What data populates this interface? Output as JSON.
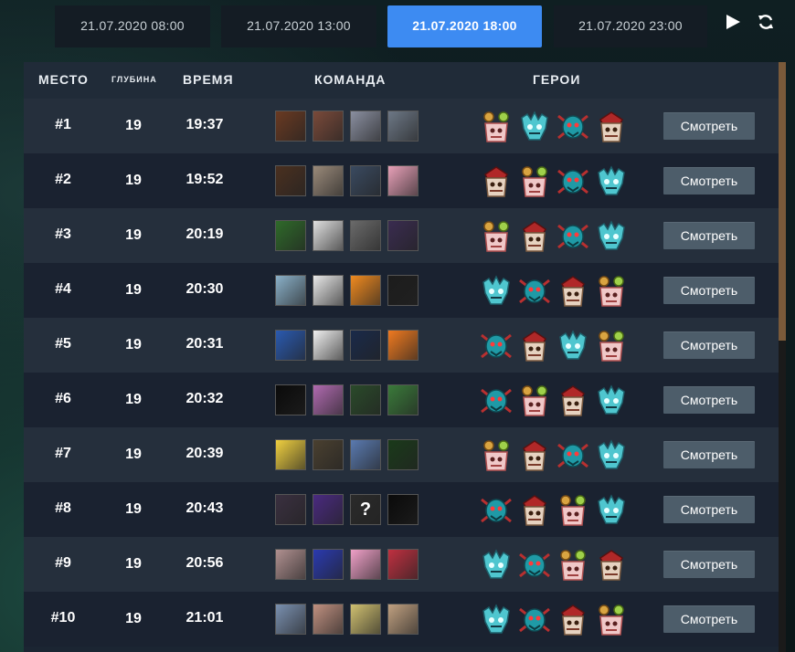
{
  "tabs": [
    {
      "label": "21.07.2020 08:00",
      "active": false
    },
    {
      "label": "21.07.2020 13:00",
      "active": false
    },
    {
      "label": "21.07.2020 18:00",
      "active": true
    },
    {
      "label": "21.07.2020 23:00",
      "active": false
    }
  ],
  "controls": {
    "play_icon": "play-icon",
    "refresh_icon": "refresh-icon"
  },
  "headers": {
    "place": "МЕСТО",
    "depth": "ГЛУБИНА",
    "time": "ВРЕМЯ",
    "team": "КОМАНДА",
    "heroes": "ГЕРОИ"
  },
  "watch_label": "Смотреть",
  "rows": [
    {
      "place": "#1",
      "depth": "19",
      "time": "19:37",
      "avatars": [
        "#6a3a22",
        "#7a4a3a",
        "#8a8fa0",
        "#6d7886"
      ],
      "heroes": [
        "shaman",
        "lich",
        "spider",
        "shaman-red"
      ]
    },
    {
      "place": "#2",
      "depth": "19",
      "time": "19:52",
      "avatars": [
        "#4a3020",
        "#9a8a7a",
        "#3a4a60",
        "#e8a0b8"
      ],
      "heroes": [
        "shaman-red",
        "shaman",
        "spider",
        "lich"
      ]
    },
    {
      "place": "#3",
      "depth": "19",
      "time": "20:19",
      "avatars": [
        "#2f6a2a",
        "#e0e0e0",
        "#6a6a6a",
        "#3a2c50"
      ],
      "heroes": [
        "shaman",
        "shaman-red",
        "spider",
        "lich"
      ]
    },
    {
      "place": "#4",
      "depth": "19",
      "time": "20:30",
      "avatars": [
        "#8ab0c8",
        "#e8e8e8",
        "#f08a20",
        "#1c1c1c"
      ],
      "heroes": [
        "lich",
        "spider",
        "shaman-red",
        "shaman"
      ]
    },
    {
      "place": "#5",
      "depth": "19",
      "time": "20:31",
      "avatars": [
        "#2a5ab0",
        "#f0f0f0",
        "#1a2a4a",
        "#f07a20"
      ],
      "heroes": [
        "spider",
        "shaman-red",
        "lich",
        "shaman"
      ]
    },
    {
      "place": "#6",
      "depth": "19",
      "time": "20:32",
      "avatars": [
        "#0a0a0a",
        "#b06ab0",
        "#2a4a2a",
        "#3a7a3a"
      ],
      "heroes": [
        "spider",
        "shaman",
        "shaman-red",
        "lich"
      ]
    },
    {
      "place": "#7",
      "depth": "19",
      "time": "20:39",
      "avatars": [
        "#f0d040",
        "#4a4030",
        "#5a7ab0",
        "#1a3a1a"
      ],
      "heroes": [
        "shaman",
        "shaman-red",
        "spider",
        "lich"
      ]
    },
    {
      "place": "#8",
      "depth": "19",
      "time": "20:43",
      "avatars": [
        "#3a3040",
        "#4a2a80",
        "#2a2a2a",
        "#0a0a0a"
      ],
      "heroes": [
        "spider",
        "shaman-red",
        "shaman",
        "lich"
      ]
    },
    {
      "place": "#9",
      "depth": "19",
      "time": "20:56",
      "avatars": [
        "#b09090",
        "#2a3ab0",
        "#f0a0c8",
        "#c03040"
      ],
      "heroes": [
        "lich",
        "spider",
        "shaman",
        "shaman-red"
      ]
    },
    {
      "place": "#10",
      "depth": "19",
      "time": "21:01",
      "avatars": [
        "#7a90b0",
        "#c09080",
        "#d0c070",
        "#c0a080"
      ],
      "heroes": [
        "lich",
        "spider",
        "shaman-red",
        "shaman"
      ]
    }
  ],
  "special_avatar_text": "?"
}
